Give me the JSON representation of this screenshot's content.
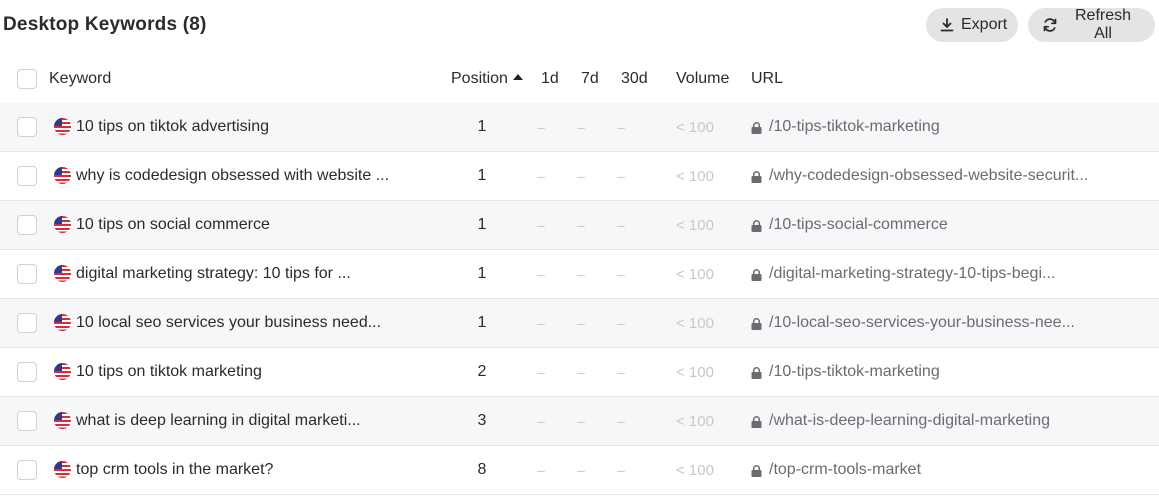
{
  "header": {
    "title": "Desktop Keywords (8)",
    "export_label": "Export",
    "refresh_label": "Refresh All"
  },
  "columns": {
    "keyword": "Keyword",
    "position": "Position",
    "d1": "1d",
    "d7": "7d",
    "d30": "30d",
    "volume": "Volume",
    "url": "URL"
  },
  "rows": [
    {
      "keyword": "10 tips on tiktok advertising",
      "position": "1",
      "d1": "–",
      "d7": "–",
      "d30": "–",
      "volume": "< 100",
      "url": "/10-tips-tiktok-marketing"
    },
    {
      "keyword": "why is codedesign obsessed with website ...",
      "position": "1",
      "d1": "–",
      "d7": "–",
      "d30": "–",
      "volume": "< 100",
      "url": "/why-codedesign-obsessed-website-securit..."
    },
    {
      "keyword": "10 tips on social commerce",
      "position": "1",
      "d1": "–",
      "d7": "–",
      "d30": "–",
      "volume": "< 100",
      "url": "/10-tips-social-commerce"
    },
    {
      "keyword": "digital marketing strategy: 10 tips for ...",
      "position": "1",
      "d1": "–",
      "d7": "–",
      "d30": "–",
      "volume": "< 100",
      "url": "/digital-marketing-strategy-10-tips-begi..."
    },
    {
      "keyword": "10 local seo services your business need...",
      "position": "1",
      "d1": "–",
      "d7": "–",
      "d30": "–",
      "volume": "< 100",
      "url": "/10-local-seo-services-your-business-nee..."
    },
    {
      "keyword": "10 tips on tiktok marketing",
      "position": "2",
      "d1": "–",
      "d7": "–",
      "d30": "–",
      "volume": "< 100",
      "url": "/10-tips-tiktok-marketing"
    },
    {
      "keyword": "what is deep learning in digital marketi...",
      "position": "3",
      "d1": "–",
      "d7": "–",
      "d30": "–",
      "volume": "< 100",
      "url": "/what-is-deep-learning-digital-marketing"
    },
    {
      "keyword": "top crm tools in the market?",
      "position": "8",
      "d1": "–",
      "d7": "–",
      "d30": "–",
      "volume": "< 100",
      "url": "/top-crm-tools-market"
    }
  ],
  "icons": {
    "flag": "us-flag-icon",
    "lock": "lock-icon",
    "export": "download-icon",
    "refresh": "refresh-icon",
    "sort": "sort-ascending-icon"
  },
  "colors": {
    "button_bg": "#e4e4e6",
    "row_shade": "#f7f7f9",
    "muted": "#c8c8cc",
    "url_text": "#6b6b70"
  }
}
